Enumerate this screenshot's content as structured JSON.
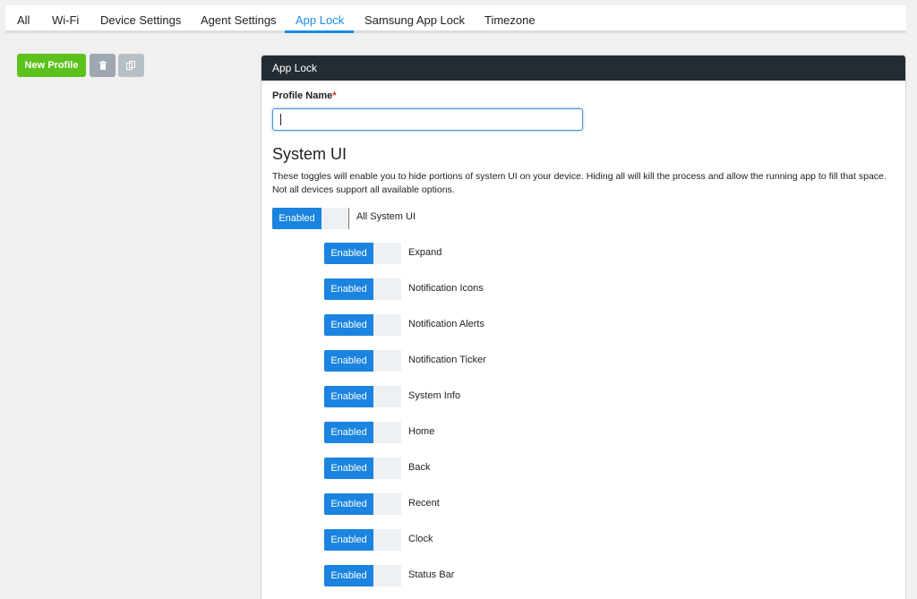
{
  "tabs": [
    {
      "label": "All"
    },
    {
      "label": "Wi-Fi"
    },
    {
      "label": "Device Settings"
    },
    {
      "label": "Agent Settings"
    },
    {
      "label": "App Lock",
      "active": true
    },
    {
      "label": "Samsung App Lock"
    },
    {
      "label": "Timezone"
    }
  ],
  "toolbar": {
    "new_profile_label": "New Profile",
    "delete_icon": "trash-icon",
    "copy_icon": "copy-icon"
  },
  "panel": {
    "title": "App Lock",
    "profile_name": {
      "label": "Profile Name",
      "required_mark": "*",
      "value": ""
    },
    "system_ui": {
      "title": "System UI",
      "description": "These toggles will enable you to hide portions of system UI on your device. Hiding all will kill the process and allow the running app to fill that space. Not all devices support all available options.",
      "master": {
        "state": "Enabled",
        "label": "All System UI"
      },
      "items": [
        {
          "state": "Enabled",
          "label": "Expand"
        },
        {
          "state": "Enabled",
          "label": "Notification Icons"
        },
        {
          "state": "Enabled",
          "label": "Notification Alerts"
        },
        {
          "state": "Enabled",
          "label": "Notification Ticker"
        },
        {
          "state": "Enabled",
          "label": "System Info"
        },
        {
          "state": "Enabled",
          "label": "Home"
        },
        {
          "state": "Enabled",
          "label": "Back"
        },
        {
          "state": "Enabled",
          "label": "Recent"
        },
        {
          "state": "Enabled",
          "label": "Clock"
        },
        {
          "state": "Enabled",
          "label": "Status Bar"
        }
      ]
    }
  },
  "colors": {
    "accent": "#1a84e0",
    "success": "#5cc21b",
    "header": "#232c33",
    "required": "#d9251d"
  }
}
